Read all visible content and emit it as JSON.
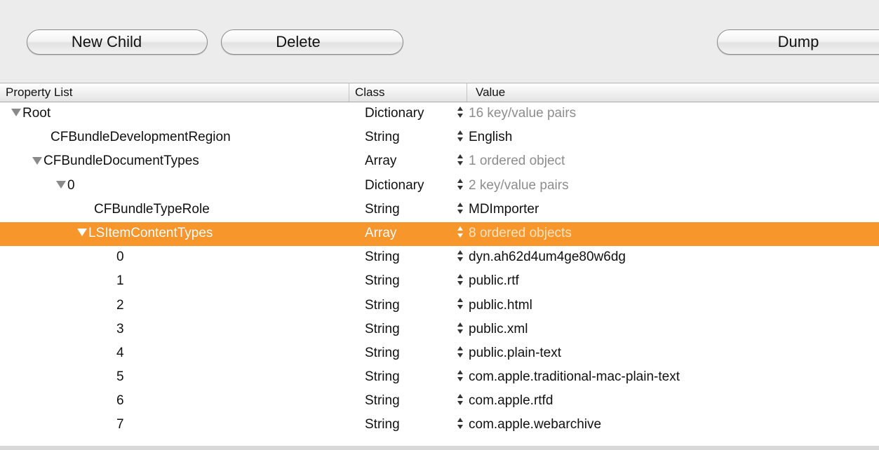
{
  "toolbar": {
    "new_child_label": "New Child",
    "delete_label": "Delete",
    "dump_label": "Dump"
  },
  "columns": {
    "property_list": "Property List",
    "class": "Class",
    "value": "Value"
  },
  "colors": {
    "selection": "#f7962a",
    "dim_value": "#8d8d8d"
  },
  "rows": [
    {
      "key": "Root",
      "class": "Dictionary",
      "value": "16 key/value pairs",
      "expanded": true,
      "dim": true
    },
    {
      "key": "CFBundleDevelopmentRegion",
      "class": "String",
      "value": "English",
      "expanded": false,
      "dim": false
    },
    {
      "key": "CFBundleDocumentTypes",
      "class": "Array",
      "value": "1 ordered object",
      "expanded": true,
      "dim": true
    },
    {
      "key": "0",
      "class": "Dictionary",
      "value": "2 key/value pairs",
      "expanded": true,
      "dim": true
    },
    {
      "key": "CFBundleTypeRole",
      "class": "String",
      "value": "MDImporter",
      "expanded": false,
      "dim": false
    },
    {
      "key": "LSItemContentTypes",
      "class": "Array",
      "value": "8 ordered objects",
      "expanded": true,
      "dim": true,
      "selected": true
    },
    {
      "key": "0",
      "class": "String",
      "value": "dyn.ah62d4um4ge80w6dg",
      "expanded": false,
      "dim": false
    },
    {
      "key": "1",
      "class": "String",
      "value": "public.rtf",
      "expanded": false,
      "dim": false
    },
    {
      "key": "2",
      "class": "String",
      "value": "public.html",
      "expanded": false,
      "dim": false
    },
    {
      "key": "3",
      "class": "String",
      "value": "public.xml",
      "expanded": false,
      "dim": false
    },
    {
      "key": "4",
      "class": "String",
      "value": "public.plain-text",
      "expanded": false,
      "dim": false
    },
    {
      "key": "5",
      "class": "String",
      "value": "com.apple.traditional-mac-plain-text",
      "expanded": false,
      "dim": false
    },
    {
      "key": "6",
      "class": "String",
      "value": "com.apple.rtfd",
      "expanded": false,
      "dim": false
    },
    {
      "key": "7",
      "class": "String",
      "value": "com.apple.webarchive",
      "expanded": false,
      "dim": false
    }
  ]
}
